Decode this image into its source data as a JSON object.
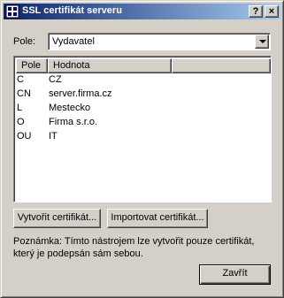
{
  "window": {
    "title": "SSL certifikát serveru",
    "help_label": "?",
    "close_label": "×"
  },
  "field": {
    "label": "Pole:",
    "selected": "Vydavatel"
  },
  "list": {
    "columns": [
      "Pole",
      "Hodnota",
      ""
    ],
    "rows": [
      {
        "pole": "C",
        "hodnota": "CZ"
      },
      {
        "pole": "CN",
        "hodnota": "server.firma.cz"
      },
      {
        "pole": "L",
        "hodnota": "Mestecko"
      },
      {
        "pole": "O",
        "hodnota": "Firma s.r.o."
      },
      {
        "pole": "OU",
        "hodnota": "IT"
      }
    ]
  },
  "buttons": {
    "create": "Vytvořit certifikát...",
    "import": "Importovat certifikát...",
    "close": "Zavřít"
  },
  "note": "Poznámka: Tímto nástrojem lze vytvořit pouze certifikát, který je podepsán sám sebou."
}
